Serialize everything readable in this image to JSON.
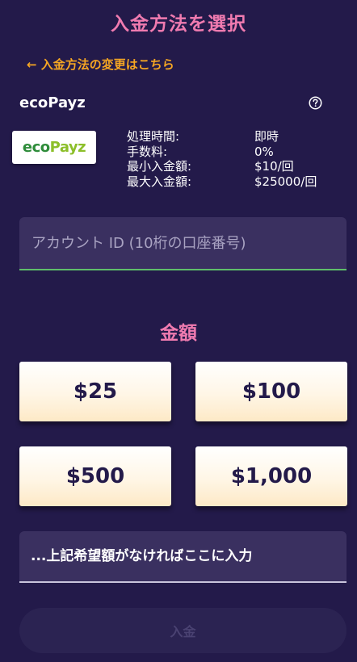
{
  "header": {
    "title": "入金方法を選択",
    "change_link": "← 入金方法の変更はこちら"
  },
  "method": {
    "name": "ecoPayz",
    "logo_text_part1": "eco",
    "logo_text_part2": "Payz",
    "help_icon": "question-circle-icon",
    "details": [
      {
        "label": "処理時間:",
        "value": "即時"
      },
      {
        "label": "手数料:",
        "value": "0%"
      },
      {
        "label": "最小入金額:",
        "value": "$10/回"
      },
      {
        "label": "最大入金額:",
        "value": "$25000/回"
      }
    ]
  },
  "account": {
    "placeholder": "アカウント ID (10桁の口座番号)"
  },
  "amount": {
    "heading": "金額",
    "options": [
      "$25",
      "$100",
      "$500",
      "$1,000"
    ],
    "custom_placeholder": "...上記希望額がなければここに入力"
  },
  "actions": {
    "deposit_label": "入金"
  },
  "colors": {
    "background": "#231a4a",
    "accent_pink": "#f07bb0",
    "link_orange": "#f5a623",
    "input_bg": "#3a3060",
    "input_focus": "#5fbf6a"
  }
}
